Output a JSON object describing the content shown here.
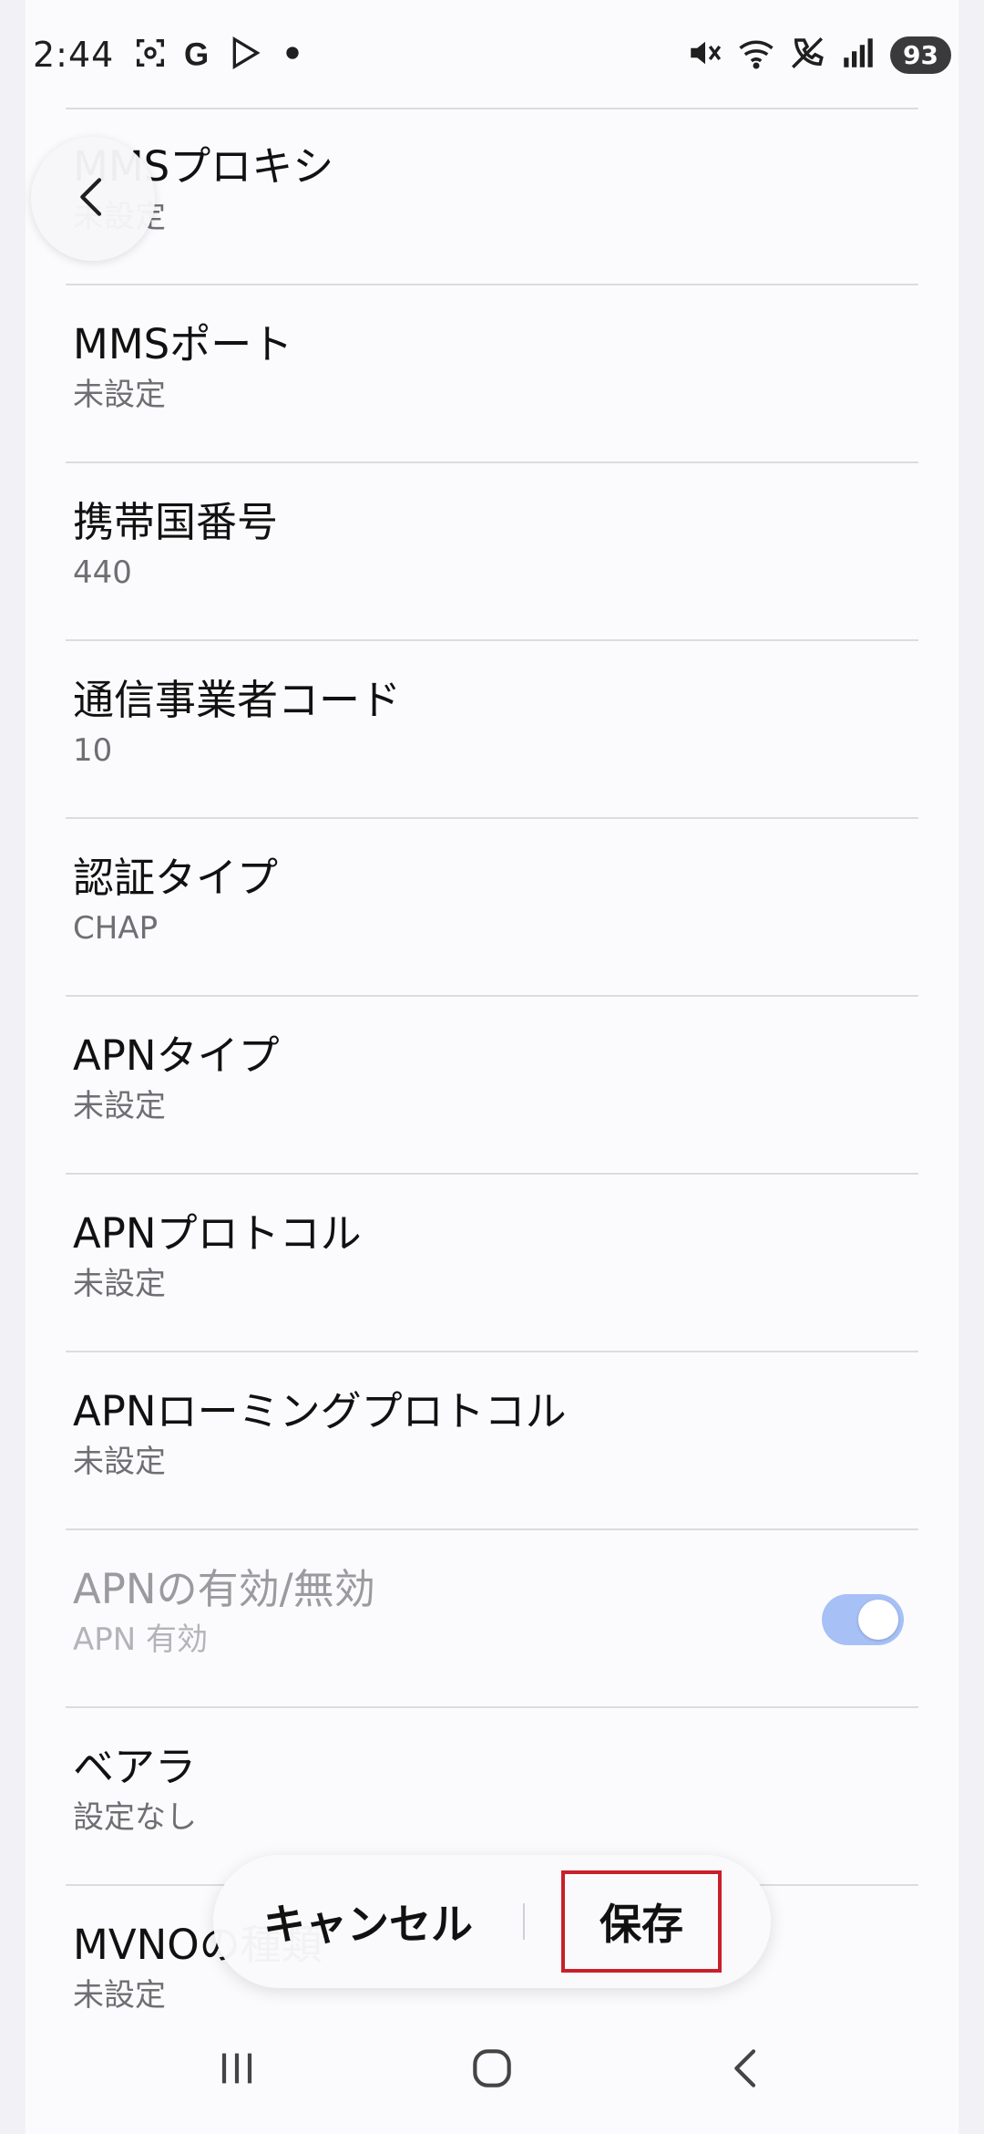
{
  "status_bar": {
    "time": "2:44",
    "battery": "93",
    "left_icons": [
      "screenshot-icon",
      "google-icon",
      "play-store-icon",
      "dot-icon"
    ],
    "right_icons": [
      "mute-icon",
      "wifi-6-icon",
      "call-blocked-icon",
      "signal-icon"
    ]
  },
  "settings": {
    "items": [
      {
        "title": "MMSプロキシ",
        "subtitle": "未設定"
      },
      {
        "title": "MMSポート",
        "subtitle": "未設定"
      },
      {
        "title": "携帯国番号",
        "subtitle": "440"
      },
      {
        "title": "通信事業者コード",
        "subtitle": "10"
      },
      {
        "title": "認証タイプ",
        "subtitle": "CHAP"
      },
      {
        "title": "APNタイプ",
        "subtitle": "未設定"
      },
      {
        "title": "APNプロトコル",
        "subtitle": "未設定"
      },
      {
        "title": "APNローミングプロトコル",
        "subtitle": "未設定"
      },
      {
        "title": "APNの有効/無効",
        "subtitle": "APN 有効",
        "toggle_on": true,
        "disabled": true
      },
      {
        "title": "ベアラ",
        "subtitle": "設定なし"
      },
      {
        "title": "MVNOの種類",
        "subtitle": "未設定"
      }
    ]
  },
  "actions": {
    "cancel_label": "キャンセル",
    "save_label": "保存"
  },
  "colors": {
    "toggle_on": "#a7c0f5",
    "highlight_border": "#c8202a",
    "background": "#f2f2f6"
  }
}
